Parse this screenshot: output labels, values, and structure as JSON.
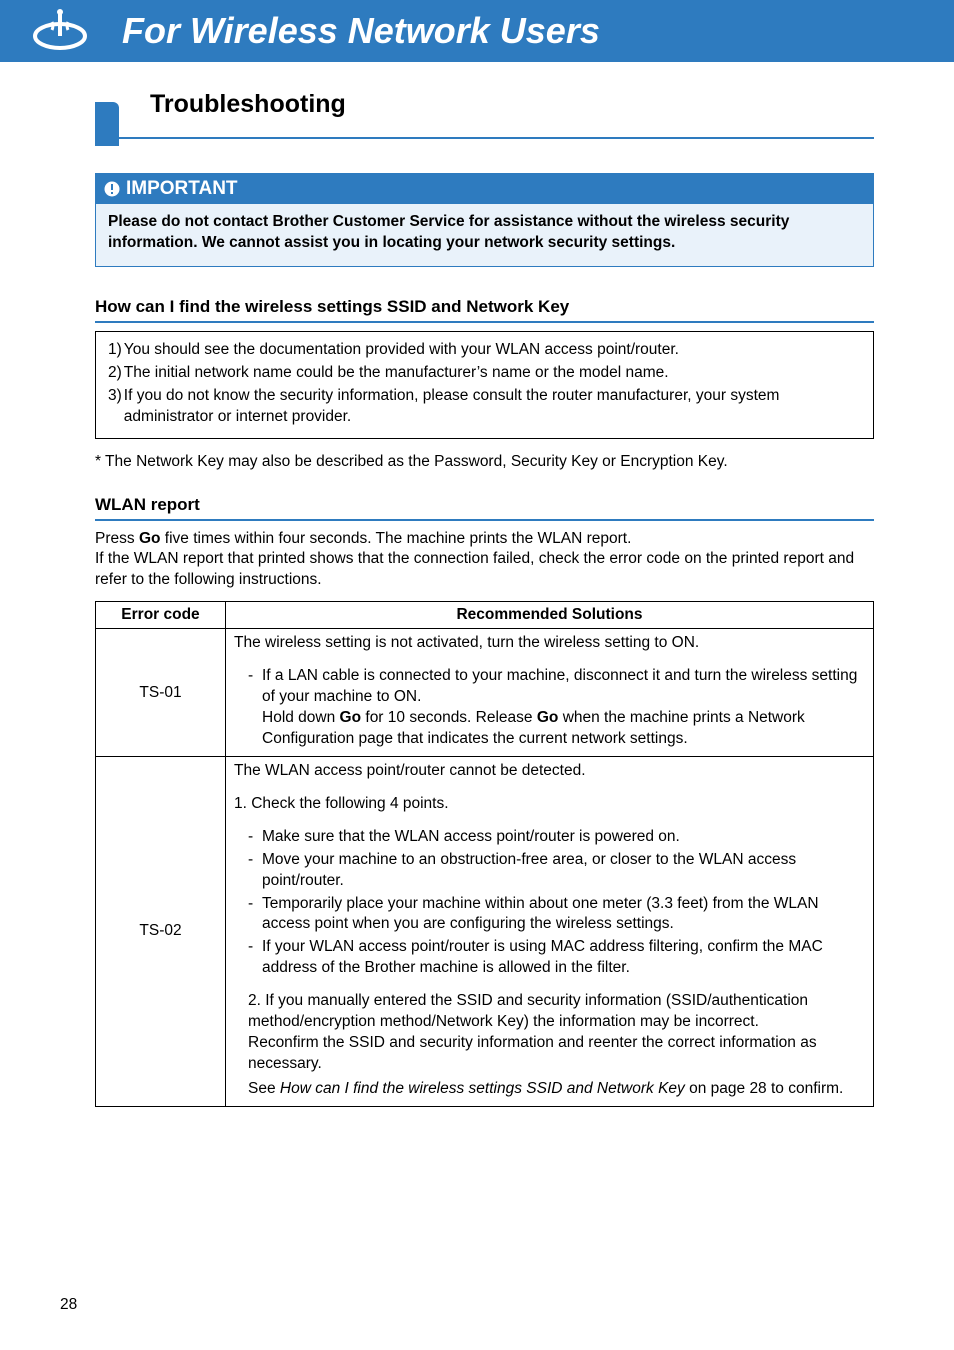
{
  "header": {
    "title": "For Wireless Network Users"
  },
  "section": {
    "title": "Troubleshooting"
  },
  "important": {
    "label": "IMPORTANT",
    "body": "Please do not contact Brother Customer Service for assistance without the wireless security information. We cannot assist you in locating your network security settings."
  },
  "find_settings": {
    "heading": "How can I find the wireless settings SSID and Network Key",
    "items": {
      "n1": "1)",
      "t1": "You should see the documentation provided with your WLAN access point/router.",
      "n2": "2)",
      "t2": "The initial network name could be the manufacturer’s name or the model name.",
      "n3": "3)",
      "t3": "If you do not know the security information, please consult the router manufacturer, your system administrator or internet provider."
    },
    "footnote": "*  The Network Key may also be described as the Password, Security Key or Encryption Key."
  },
  "wlan_report": {
    "heading": "WLAN report",
    "para_pre": "Press ",
    "go": "Go",
    "para_mid": " five times within four seconds. The machine prints the WLAN report.",
    "para2": "If the WLAN report that printed shows that the connection failed, check the error code on the printed report and refer to the following instructions."
  },
  "table": {
    "h_code": "Error code",
    "h_sol": "Recommended Solutions",
    "rows": [
      {
        "code": "TS-01",
        "p1": "The wireless setting is not activated, turn the wireless setting to ON.",
        "dash1": "If a LAN cable is connected to your machine, disconnect it and turn the wireless setting of your machine to ON.",
        "line_a": "Hold down ",
        "go1": "Go",
        "line_b": " for 10 seconds. Release ",
        "go2": "Go",
        "line_c": " when the machine prints a Network Configuration page that indicates the current network settings."
      },
      {
        "code": "TS-02",
        "p1": "The WLAN access point/router cannot be detected.",
        "p2": "1. Check the following 4 points.",
        "d1": "Make sure that the WLAN access point/router is powered on.",
        "d2": "Move your machine to an obstruction-free area, or closer to the WLAN access point/router.",
        "d3": "Temporarily place your machine within about one meter (3.3 feet) from the WLAN access point when you are configuring the wireless settings.",
        "d4": "If your WLAN access point/router is using MAC address filtering, confirm the MAC address of the Brother machine is allowed in the filter.",
        "p3_a": "2. If you manually entered the SSID and security information (SSID/authentication method/encryption method/Network Key) the information may be incorrect.",
        "p3_b": "Reconfirm the SSID and security information and reenter the correct information as necessary.",
        "see_a": "See ",
        "see_i": "How can I find the wireless settings SSID and Network Key",
        "see_b": " on page 28 to confirm."
      }
    ]
  },
  "page_number": "28"
}
